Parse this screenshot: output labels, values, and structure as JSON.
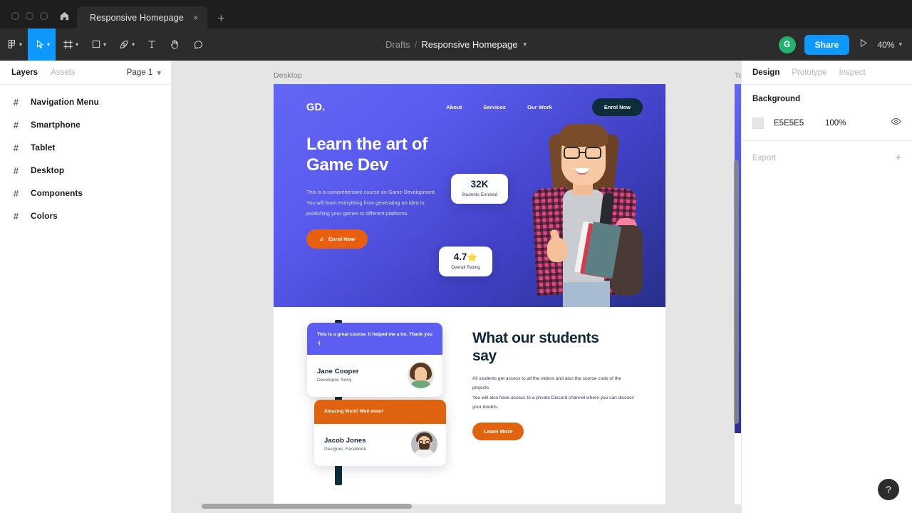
{
  "window": {
    "tab_title": "Responsive Homepage",
    "close_glyph": "×",
    "new_tab_glyph": "+",
    "home_icon": "home-icon"
  },
  "toolbar": {
    "tools": [
      {
        "name": "figma-menu-icon",
        "caret": true
      },
      {
        "name": "move-tool-icon",
        "caret": true,
        "active": true
      },
      {
        "name": "frame-tool-icon",
        "caret": true
      },
      {
        "name": "shape-tool-icon",
        "caret": true
      },
      {
        "name": "pen-tool-icon",
        "caret": true
      },
      {
        "name": "text-tool-icon",
        "caret": false
      },
      {
        "name": "hand-tool-icon",
        "caret": false
      },
      {
        "name": "comment-tool-icon",
        "caret": false
      }
    ],
    "breadcrumb_project": "Drafts",
    "breadcrumb_sep": "/",
    "breadcrumb_file": "Responsive Homepage",
    "avatar_initial": "G",
    "share_label": "Share",
    "present_icon": "play-icon",
    "zoom_level": "40%",
    "accent_color": "#0d99ff"
  },
  "left_panel": {
    "tabs": [
      {
        "label": "Layers",
        "active": true
      },
      {
        "label": "Assets",
        "active": false
      }
    ],
    "page_selector": "Page 1",
    "layers": [
      {
        "label": "Navigation Menu",
        "icon": "frame-icon"
      },
      {
        "label": "Smartphone",
        "icon": "frame-icon"
      },
      {
        "label": "Tablet",
        "icon": "frame-icon"
      },
      {
        "label": "Desktop",
        "icon": "frame-icon"
      },
      {
        "label": "Components",
        "icon": "frame-icon"
      },
      {
        "label": "Colors",
        "icon": "frame-icon"
      }
    ]
  },
  "right_panel": {
    "tabs": [
      {
        "label": "Design",
        "active": true
      },
      {
        "label": "Prototype",
        "active": false
      },
      {
        "label": "Inspect",
        "active": false
      }
    ],
    "background": {
      "title": "Background",
      "hex": "E5E5E5",
      "opacity": "100%",
      "visibility_icon": "eye-icon"
    },
    "export": {
      "label": "Export",
      "add_glyph": "+"
    }
  },
  "canvas": {
    "background_color": "#e5e5e5",
    "frames": [
      {
        "label": "Desktop"
      },
      {
        "label": "Ta"
      }
    ],
    "desktop": {
      "hero": {
        "logo": "GD.",
        "nav_links": [
          "About",
          "Services",
          "Our Work"
        ],
        "nav_cta": "Enrol Now",
        "heading_line1": "Learn the art of",
        "heading_line2": "Game Dev",
        "paragraph": "This is a comprehensive course on Game Development. You will learn everything from generating an idea to publishing your games to different platforms.",
        "cta_label": "Enrol Now",
        "cta_icon": "edit-icon",
        "gradient_from": "#6366f4",
        "gradient_to": "#272f88",
        "cta_color": "#e8600f",
        "nav_cta_color": "#0e2c3a",
        "stats": [
          {
            "value": "32K",
            "label": "Students Enrolled"
          },
          {
            "value": "4.7",
            "star": "⭐",
            "label": "Overall Rating"
          }
        ],
        "photo": "student-photo"
      },
      "testimonials": {
        "heading_line1": "What our students",
        "heading_line2": "say",
        "paragraph_1": "All students get access to all the videos and also the source code of the projects.",
        "paragraph_2": "You will also have access to a private Discord channel where you can discuss your doubts.",
        "button_label": "Learn More",
        "cards": [
          {
            "quote": "This is a great course. It helped me a lot. Thank you :)",
            "name": "Jane Cooper",
            "role": "Developer, Sony",
            "quote_color": "#5b5ef0",
            "avatar": "jane-cooper-avatar"
          },
          {
            "quote": "Amazing Work! Well done!",
            "name": "Jacob Jones",
            "role": "Designer, Facebook",
            "quote_color": "#e0640f",
            "avatar": "jacob-jones-avatar"
          }
        ]
      }
    }
  },
  "help": {
    "glyph": "?"
  }
}
